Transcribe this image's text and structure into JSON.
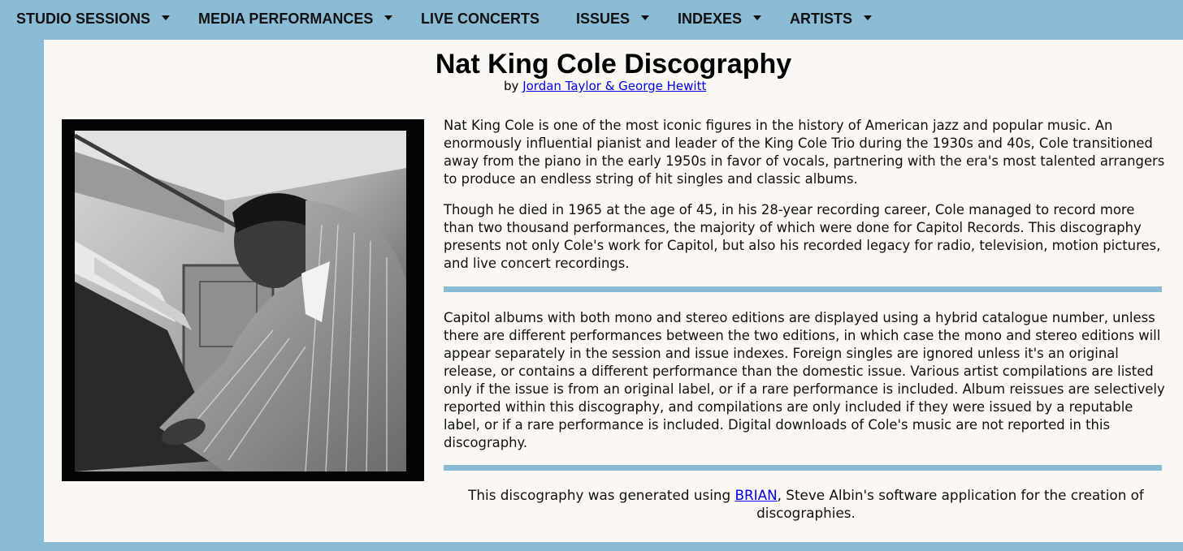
{
  "nav": {
    "items": [
      {
        "label": "STUDIO SESSIONS",
        "has_dropdown": true
      },
      {
        "label": "MEDIA PERFORMANCES",
        "has_dropdown": true
      },
      {
        "label": "LIVE CONCERTS",
        "has_dropdown": false
      },
      {
        "label": "ISSUES",
        "has_dropdown": true
      },
      {
        "label": "INDEXES",
        "has_dropdown": true
      },
      {
        "label": "ARTISTS",
        "has_dropdown": true
      }
    ]
  },
  "page": {
    "title": "Nat King Cole Discography",
    "by_prefix": "by",
    "authors_link": "Jordan Taylor & George Hewitt"
  },
  "content": {
    "p1": "Nat King Cole is one of the most iconic figures in the history of American jazz and popular music. An enormously influential pianist and leader of the King Cole Trio during the 1930s and 40s, Cole transitioned away from the piano in the early 1950s in favor of vocals, partnering with the era's most talented arrangers to produce an endless string of hit singles and classic albums.",
    "p2": "Though he died in 1965 at the age of 45, in his 28-year recording career, Cole managed to record more than two thousand performances, the majority of which were done for Capitol Records. This discography presents not only Cole's work for Capitol, but also his recorded legacy for radio, television, motion pictures, and live concert recordings.",
    "p3": "Capitol albums with both mono and stereo editions are displayed using a hybrid catalogue number, unless there are different performances between the two editions, in which case the mono and stereo editions will appear separately in the session and issue indexes. Foreign singles are ignored unless it's an original release, or contains a different performance than the domestic issue. Various artist compilations are listed only if the issue is from an original label, or if a rare performance is included. Album reissues are selectively reported within this discography, and compilations are only included if they were issued by a reputable label, or if a rare performance is included. Digital downloads of Cole's music are not reported in this discography.",
    "footer_before": "This discography was generated using ",
    "footer_link": "BRIAN",
    "footer_after": ", Steve Albin's software application for the creation of discographies."
  },
  "colors": {
    "background": "#8bbcd5",
    "panel": "#fbf7f3",
    "link": "#0000ee",
    "rule": "#8bbcd5"
  }
}
